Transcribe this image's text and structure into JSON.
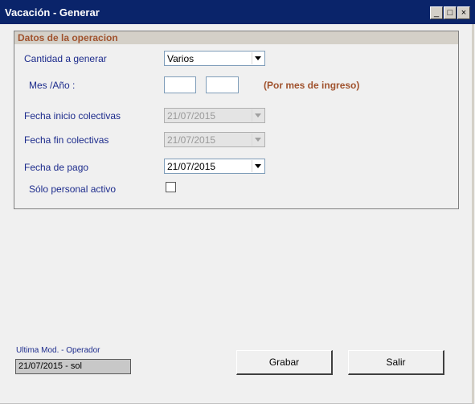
{
  "window": {
    "title": "Vacación - Generar",
    "buttons": {
      "minimize": "_",
      "maximize": "□",
      "close": "×"
    }
  },
  "form": {
    "group_title": "Datos de la operacion",
    "cantidad_label": "Cantidad a generar",
    "cantidad_value": "Varios",
    "mes_anio_label": "Mes /Año :",
    "mes_value": "",
    "anio_value": "",
    "mes_hint": "(Por mes de ingreso)",
    "fecha_inicio_label": "Fecha inicio colectivas",
    "fecha_inicio_value": "21/07/2015",
    "fecha_fin_label": "Fecha fin colectivas",
    "fecha_fin_value": "21/07/2015",
    "fecha_pago_label": "Fecha de pago",
    "fecha_pago_value": "21/07/2015",
    "solo_activo_label": "Sólo personal activo",
    "solo_activo_checked": false
  },
  "status": {
    "label": "Ultima Mod. - Operador",
    "value": "21/07/2015 - sol"
  },
  "buttons": {
    "grabar": "Grabar",
    "salir": "Salir"
  },
  "colors": {
    "titlebar": "#0a246a",
    "label_text": "#1c2b8c",
    "accent_text": "#a0522d"
  }
}
